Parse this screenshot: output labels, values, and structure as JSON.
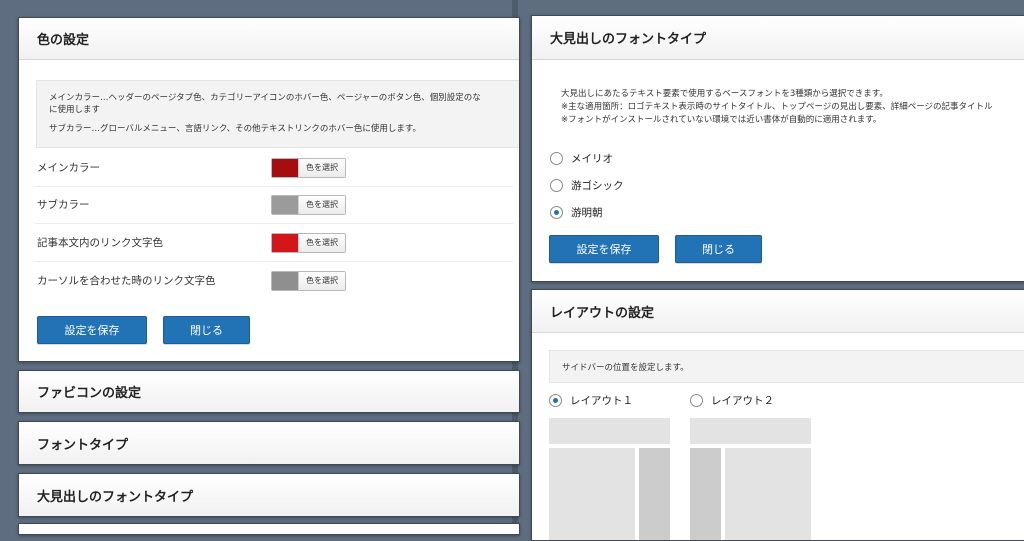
{
  "colors": {
    "main": "#a40e10",
    "sub": "#9b9b9b",
    "link": "#d2161a",
    "hover": "#8f8f8f",
    "button": "#2273b5"
  },
  "color_panel": {
    "title": "色の設定",
    "desc_line1": "メインカラー…ヘッダーのページタブ色、カテゴリーアイコンのホバー色、ページャーのボタン色、個別設定のな",
    "desc_line2": "に使用します",
    "desc_line3": "サブカラー…グローバルメニュー、言語リンク、その他テキストリンクのホバー色に使用します。",
    "rows": [
      {
        "label": "メインカラー",
        "picker": "色を選択"
      },
      {
        "label": "サブカラー",
        "picker": "色を選択"
      },
      {
        "label": "記事本文内のリンク文字色",
        "picker": "色を選択"
      },
      {
        "label": "カーソルを合わせた時のリンク文字色",
        "picker": "色を選択"
      }
    ],
    "save": "設定を保存",
    "close": "閉じる"
  },
  "collapsed": {
    "favicon": "ファビコンの設定",
    "font_type": "フォントタイプ",
    "heading_font": "大見出しのフォントタイプ"
  },
  "heading_font_panel": {
    "title": "大見出しのフォントタイプ",
    "desc_line1": "大見出しにあたるテキスト要素で使用するベースフォントを3種類から選択できます。",
    "desc_line2": "※主な適用箇所：ロゴテキスト表示時のサイトタイトル、トップページの見出し要素、詳細ページの記事タイトル",
    "desc_line3": "※フォントがインストールされていない環境では近い書体が自動的に適用されます。",
    "options": [
      "メイリオ",
      "游ゴシック",
      "游明朝"
    ],
    "selected": "游明朝",
    "save": "設定を保存",
    "close": "閉じる"
  },
  "layout_panel": {
    "title": "レイアウトの設定",
    "desc": "サイドバーの位置を設定します。",
    "options": [
      "レイアウト１",
      "レイアウト２"
    ],
    "selected": "レイアウト１"
  }
}
